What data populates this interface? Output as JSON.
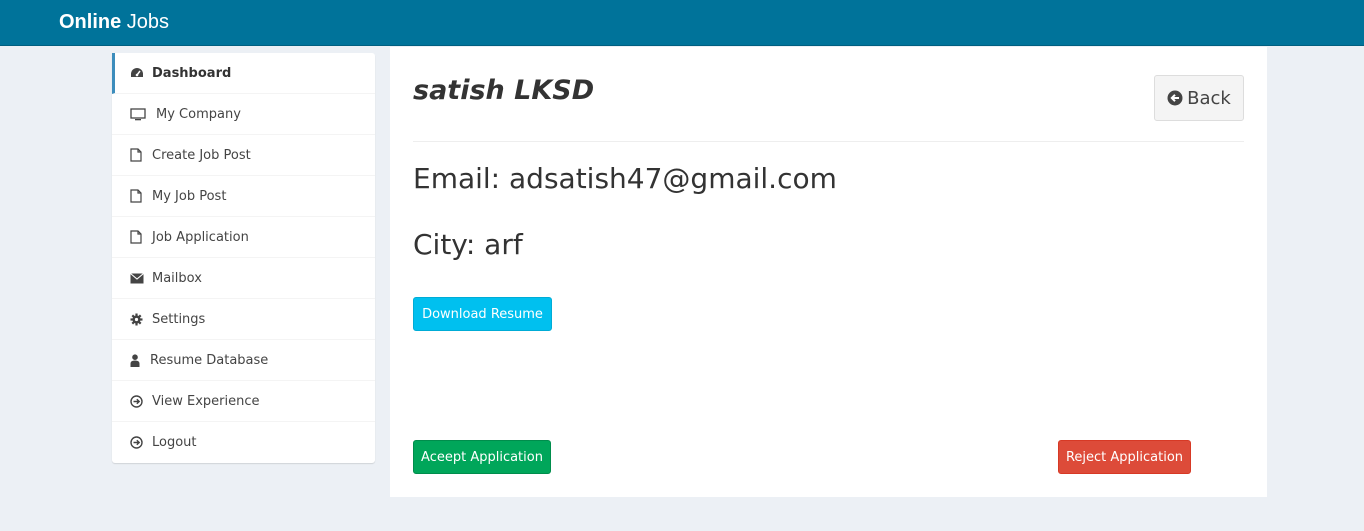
{
  "header": {
    "brand_bold": "Online",
    "brand_rest": " Jobs"
  },
  "sidebar": {
    "items": [
      {
        "label": "Dashboard",
        "icon": "dashboard-icon",
        "active": true
      },
      {
        "label": "My Company",
        "icon": "desktop-icon"
      },
      {
        "label": "Create Job Post",
        "icon": "file-icon"
      },
      {
        "label": "My Job Post",
        "icon": "file-icon"
      },
      {
        "label": "Job Application",
        "icon": "file-icon"
      },
      {
        "label": "Mailbox",
        "icon": "envelope-icon"
      },
      {
        "label": "Settings",
        "icon": "gear-icon"
      },
      {
        "label": "Resume Database",
        "icon": "user-icon"
      },
      {
        "label": "View Experience",
        "icon": "arrow-circle-icon"
      },
      {
        "label": "Logout",
        "icon": "arrow-circle-icon"
      }
    ]
  },
  "applicant": {
    "name": "satish LKSD",
    "email_line": "Email: adsatish47@gmail.com",
    "city_line": "City: arf"
  },
  "actions": {
    "back_label": "Back",
    "download_label": "Download Resume",
    "accept_label": "Aceept Application",
    "reject_label": "Reject Application"
  },
  "colors": {
    "topbar": "#00739a",
    "accept": "#00a65a",
    "reject": "#dd4b39",
    "download": "#00c0ef",
    "active_border": "#3c8dbc"
  }
}
